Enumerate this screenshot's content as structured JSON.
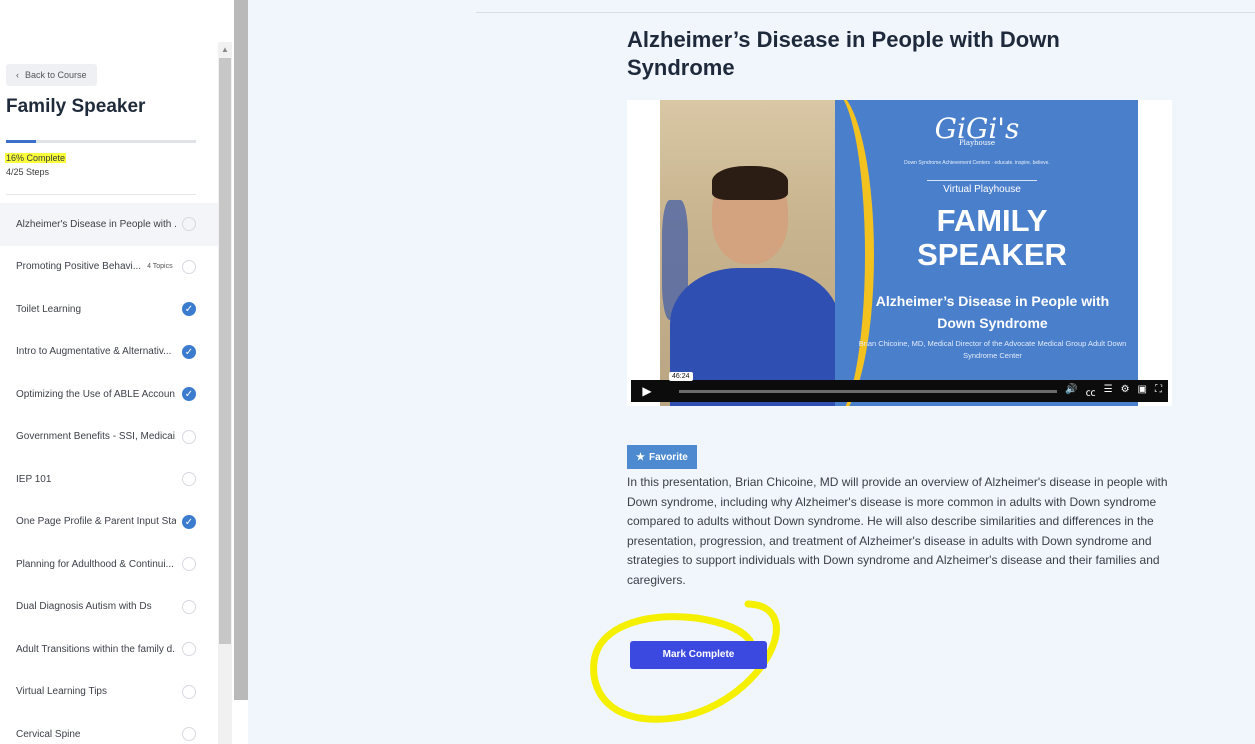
{
  "sidebar": {
    "back_label": "Back to Course",
    "course_title": "Family Speaker",
    "progress_percent": 16,
    "progress_text": "16% Complete",
    "steps_text": "4/25 Steps",
    "lessons": [
      {
        "label": "Alzheimer's Disease in People with ...",
        "topics": "",
        "done": false
      },
      {
        "label": "Promoting Positive Behavi...",
        "topics": "4 Topics",
        "done": false
      },
      {
        "label": "Toilet Learning",
        "topics": "",
        "done": true
      },
      {
        "label": "Intro to Augmentative & Alternativ...",
        "topics": "",
        "done": true
      },
      {
        "label": "Optimizing the Use of ABLE Accoun...",
        "topics": "",
        "done": true
      },
      {
        "label": "Government Benefits - SSI, Medicai...",
        "topics": "",
        "done": false
      },
      {
        "label": "IEP 101",
        "topics": "",
        "done": false
      },
      {
        "label": "One Page Profile & Parent Input Sta...",
        "topics": "",
        "done": true
      },
      {
        "label": "Planning for Adulthood & Continui...",
        "topics": "",
        "done": false
      },
      {
        "label": "Dual Diagnosis Autism with Ds",
        "topics": "",
        "done": false
      },
      {
        "label": "Adult Transitions within the family d...",
        "topics": "",
        "done": false
      },
      {
        "label": "Virtual Learning Tips",
        "topics": "",
        "done": false
      },
      {
        "label": "Cervical Spine",
        "topics": "",
        "done": false
      }
    ]
  },
  "main": {
    "title": "Alzheimer’s Disease in People with Down Syndrome",
    "video": {
      "logo": "GiGi's",
      "logo_sub": "Playhouse",
      "tagline": "Down Syndrome Achievement Centers · educate. inspire. believe.",
      "virtual_label": "Virtual Playhouse",
      "headline_1": "FAMILY",
      "headline_2": "SPEAKER",
      "subtitle": "Alzheimer’s Disease in People with Down Syndrome",
      "credit": "Brian Chicoine, MD, Medical Director of the Advocate Medical Group Adult Down Syndrome Center",
      "timestamp": "46:24"
    },
    "favorite_label": "Favorite",
    "description": "In this presentation, Brian Chicoine, MD will provide an overview of Alzheimer's disease in people with Down syndrome, including why Alzheimer's disease is more common in adults with Down syndrome compared to adults without Down syndrome. He will also describe similarities and differences in the presentation, progression, and treatment of Alzheimer's disease in adults with Down syndrome and strategies to support individuals with Down syndrome and Alzheimer's disease and their families and caregivers.",
    "mark_complete_label": "Mark Complete"
  },
  "colors": {
    "accent": "#3b49e0",
    "check": "#3b7ccf",
    "highlight": "#f9ff3a"
  }
}
